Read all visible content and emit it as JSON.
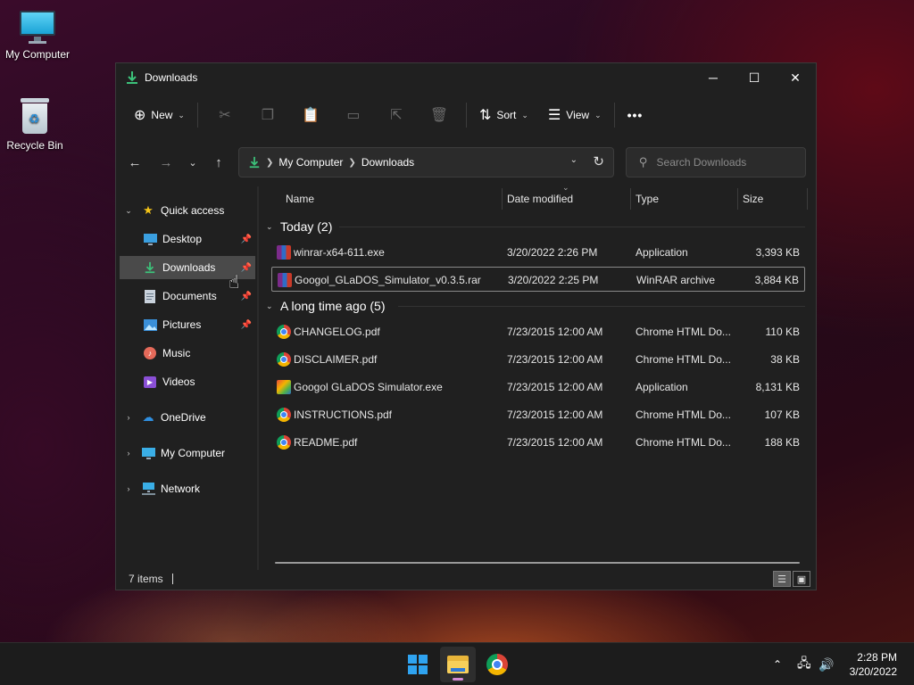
{
  "desktop": {
    "icons": [
      {
        "label": "My Computer"
      },
      {
        "label": "Recycle Bin"
      }
    ]
  },
  "window": {
    "title": "Downloads",
    "controls": {
      "minimize": "─",
      "maximize": "☐",
      "close": "✕"
    }
  },
  "toolbar": {
    "new_label": "New",
    "sort_label": "Sort",
    "view_label": "View",
    "more_label": "•••",
    "icons": [
      "cut-icon",
      "copy-icon",
      "paste-icon",
      "rename-icon",
      "share-icon",
      "delete-icon"
    ]
  },
  "address": {
    "crumbs": [
      "My Computer",
      "Downloads"
    ],
    "search_placeholder": "Search Downloads"
  },
  "sidebar": {
    "quick_access": "Quick access",
    "items": [
      {
        "label": "Desktop",
        "icon": "desktop-icon"
      },
      {
        "label": "Downloads",
        "icon": "download-icon"
      },
      {
        "label": "Documents",
        "icon": "documents-icon"
      },
      {
        "label": "Pictures",
        "icon": "pictures-icon"
      },
      {
        "label": "Music",
        "icon": "music-icon"
      },
      {
        "label": "Videos",
        "icon": "videos-icon"
      }
    ],
    "onedrive": "OneDrive",
    "my_computer": "My Computer",
    "network": "Network"
  },
  "columns": {
    "name": "Name",
    "date": "Date modified",
    "type": "Type",
    "size": "Size"
  },
  "groups": [
    {
      "label": "Today (2)",
      "files": [
        {
          "name": "winrar-x64-611.exe",
          "date": "3/20/2022 2:26 PM",
          "type": "Application",
          "size": "3,393 KB",
          "icon": "winrar-icon"
        },
        {
          "name": "Googol_GLaDOS_Simulator_v0.3.5.rar",
          "date": "3/20/2022 2:25 PM",
          "type": "WinRAR archive",
          "size": "3,884 KB",
          "icon": "rar-archive-icon"
        }
      ]
    },
    {
      "label": "A long time ago (5)",
      "files": [
        {
          "name": "CHANGELOG.pdf",
          "date": "7/23/2015 12:00 AM",
          "type": "Chrome HTML Do...",
          "size": "110 KB",
          "icon": "chrome-pdf-icon"
        },
        {
          "name": "DISCLAIMER.pdf",
          "date": "7/23/2015 12:00 AM",
          "type": "Chrome HTML Do...",
          "size": "38 KB",
          "icon": "chrome-pdf-icon"
        },
        {
          "name": "Googol GLaDOS Simulator.exe",
          "date": "7/23/2015 12:00 AM",
          "type": "Application",
          "size": "8,131 KB",
          "icon": "app-icon"
        },
        {
          "name": "INSTRUCTIONS.pdf",
          "date": "7/23/2015 12:00 AM",
          "type": "Chrome HTML Do...",
          "size": "107 KB",
          "icon": "chrome-pdf-icon"
        },
        {
          "name": "README.pdf",
          "date": "7/23/2015 12:00 AM",
          "type": "Chrome HTML Do...",
          "size": "188 KB",
          "icon": "chrome-pdf-icon"
        }
      ]
    }
  ],
  "status": {
    "item_count": "7 items"
  },
  "taskbar": {
    "apps": [
      "start-icon",
      "file-explorer-icon",
      "chrome-icon"
    ],
    "time": "2:28 PM",
    "date": "3/20/2022"
  },
  "colors": {
    "accent": "#2fa3f0",
    "window_bg": "#202020",
    "selected": "#4a4a4a",
    "download_green": "#3cc27a"
  }
}
